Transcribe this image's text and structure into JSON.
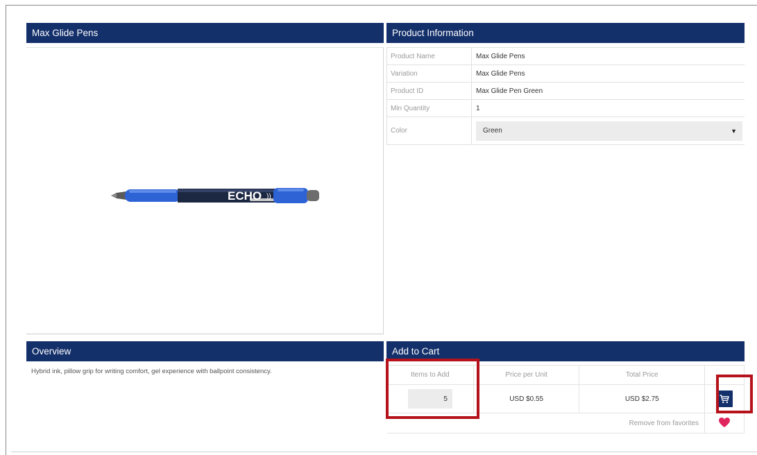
{
  "product_panel": {
    "title": "Max Glide Pens",
    "image_text": "ECHO"
  },
  "info_panel": {
    "title": "Product Information",
    "rows": [
      {
        "label": "Product Name",
        "value": "Max Glide Pens"
      },
      {
        "label": "Variation",
        "value": "Max Glide Pens"
      },
      {
        "label": "Product ID",
        "value": "Max Glide Pen Green"
      },
      {
        "label": "Min Quantity",
        "value": "1"
      }
    ],
    "color": {
      "label": "Color",
      "selected": "Green"
    }
  },
  "overview": {
    "title": "Overview",
    "text": "Hybrid ink, pillow grip for writing comfort, gel experience with ballpoint consistency."
  },
  "cart": {
    "title": "Add to Cart",
    "headers": {
      "items": "Items to Add",
      "price": "Price per Unit",
      "total": "Total Price"
    },
    "quantity": "5",
    "price_per_unit": "USD $0.55",
    "total_price": "USD $2.75",
    "remove_favorites": "Remove from favorites"
  },
  "colors": {
    "header_bg": "#14306b",
    "highlight": "#b5121b",
    "heart": "#e0245e",
    "pen_blue": "#2e63d6"
  },
  "icons": {
    "cart": "cart-icon",
    "heart": "heart-icon",
    "dropdown": "chevron-down-icon"
  }
}
